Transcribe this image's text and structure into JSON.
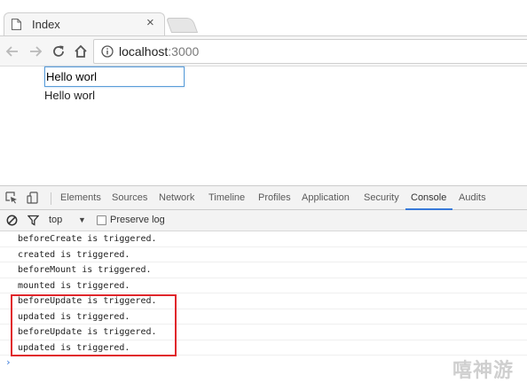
{
  "browser": {
    "tab_title": "Index",
    "tab_close": "×",
    "url_host": "localhost",
    "url_port": ":3000"
  },
  "page": {
    "input_value": "Hello worl",
    "echo_text": "Hello worl"
  },
  "devtools": {
    "tabs": [
      "Elements",
      "Sources",
      "Network",
      "Timeline",
      "Profiles",
      "Application",
      "Security",
      "Console",
      "Audits"
    ],
    "active_tab": "Console",
    "context": "top",
    "context_arrow": "▼",
    "preserve_log_label": "Preserve log",
    "prompt": "›"
  },
  "console": {
    "lines": [
      "beforeCreate is triggered.",
      "created is triggered.",
      "beforeMount is triggered.",
      "mounted is triggered.",
      "beforeUpdate is triggered.",
      "updated is triggered.",
      "beforeUpdate is triggered.",
      "updated is triggered."
    ]
  },
  "colors": {
    "highlight": "#e0262b",
    "accent": "#3879d9"
  },
  "watermark": "嘻神游"
}
